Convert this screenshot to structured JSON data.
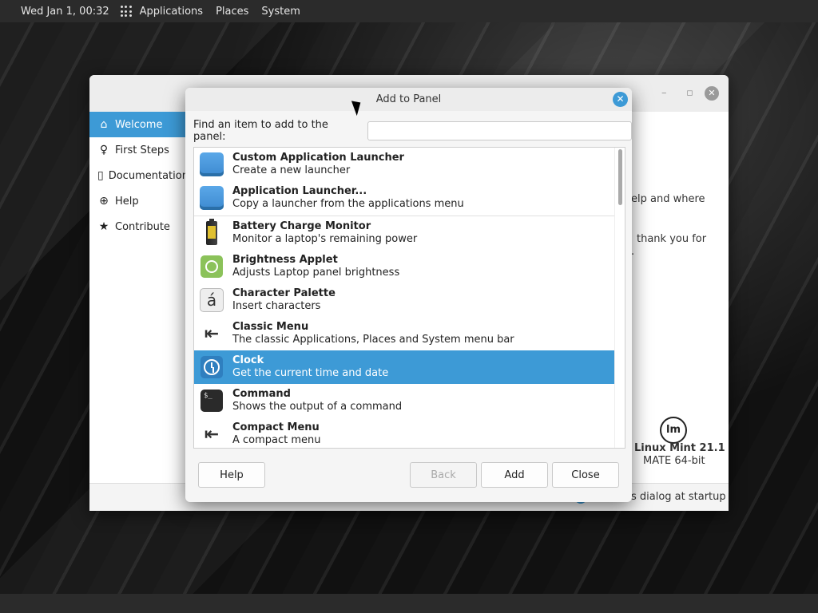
{
  "top_panel": {
    "clock": "Wed Jan  1, 00:32",
    "menus": [
      "Applications",
      "Places",
      "System"
    ]
  },
  "welcome_window": {
    "sidebar": [
      {
        "label": "Welcome",
        "icon": "home-icon",
        "active": true
      },
      {
        "label": "First Steps",
        "icon": "lightbulb-icon",
        "active": false
      },
      {
        "label": "Documentation",
        "icon": "book-icon",
        "active": false
      },
      {
        "label": "Help",
        "icon": "lifebuoy-icon",
        "active": false
      },
      {
        "label": "Contribute",
        "icon": "star-icon",
        "active": false
      }
    ],
    "text_fragment_1": "elp and where",
    "text_fragment_2": "thank you for",
    "text_fragment_3": ".",
    "distro_name": "Linux Mint 21.1",
    "distro_edition": "MATE 64-bit",
    "footer_text": "s dialog at startup"
  },
  "dialog": {
    "title": "Add to Panel",
    "search_label": "Find an item to add to the panel:",
    "search_value": "",
    "items": [
      {
        "title": "Custom Application Launcher",
        "subtitle": "Create a new launcher",
        "icon": "launcher-icon"
      },
      {
        "title": "Application Launcher...",
        "subtitle": "Copy a launcher from the applications menu",
        "icon": "launcher-icon"
      },
      {
        "title": "Battery Charge Monitor",
        "subtitle": "Monitor a laptop's remaining power",
        "icon": "battery-icon"
      },
      {
        "title": "Brightness Applet",
        "subtitle": "Adjusts Laptop panel brightness",
        "icon": "brightness-icon"
      },
      {
        "title": "Character Palette",
        "subtitle": "Insert characters",
        "icon": "character-icon"
      },
      {
        "title": "Classic Menu",
        "subtitle": "The classic Applications, Places and System menu bar",
        "icon": "arrow-left-icon"
      },
      {
        "title": "Clock",
        "subtitle": "Get the current time and date",
        "icon": "clock-icon",
        "selected": true
      },
      {
        "title": "Command",
        "subtitle": "Shows the output of a command",
        "icon": "terminal-icon"
      },
      {
        "title": "Compact Menu",
        "subtitle": "A compact menu",
        "icon": "arrow-left-icon"
      }
    ],
    "buttons": {
      "help": "Help",
      "back": "Back",
      "add": "Add",
      "close": "Close"
    }
  },
  "colors": {
    "accent": "#3d9ad6",
    "panel": "#2b2b2b"
  }
}
